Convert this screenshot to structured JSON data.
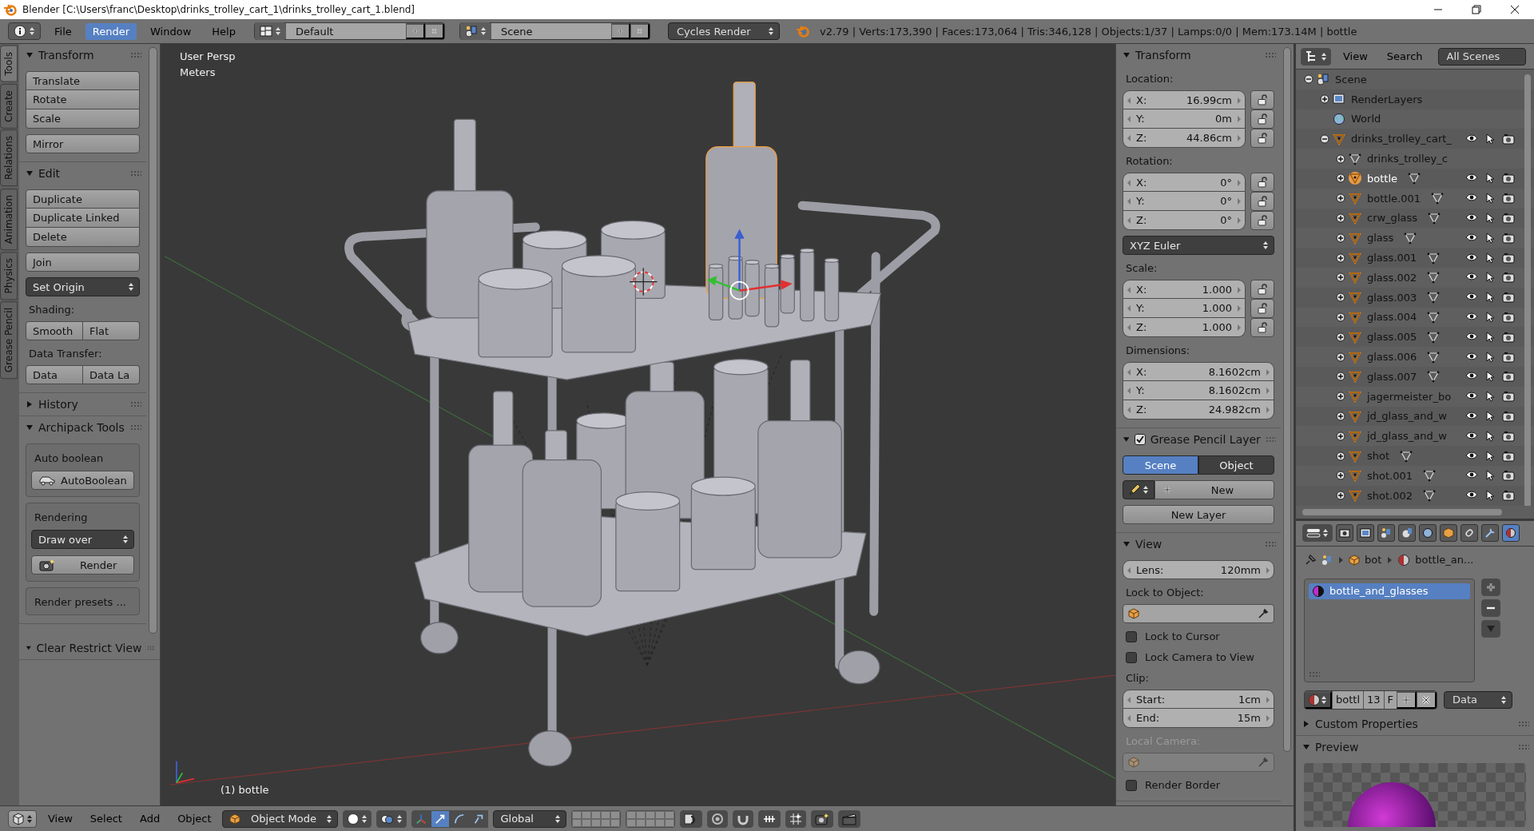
{
  "window": {
    "title": "Blender [C:\\Users\\franc\\Desktop\\drinks_trolley_cart_1\\drinks_trolley_cart_1.blend]"
  },
  "top_header": {
    "menus": [
      {
        "label": "File",
        "selected": false
      },
      {
        "label": "Render",
        "selected": true
      },
      {
        "label": "Window",
        "selected": false
      },
      {
        "label": "Help",
        "selected": false
      }
    ],
    "layout": "Default",
    "scene": "Scene",
    "engine": "Cycles Render",
    "stats": "v2.79 | Verts:173,390 | Faces:173,064 | Tris:346,128 | Objects:1/37 | Lamps:0/0 | Mem:173.14M | bottle"
  },
  "tool_tabs": [
    {
      "label": "Tools",
      "selected": true
    },
    {
      "label": "Create",
      "selected": false
    },
    {
      "label": "Relations",
      "selected": false
    },
    {
      "label": "Animation",
      "selected": false
    },
    {
      "label": "Physics",
      "selected": false
    },
    {
      "label": "Grease Pencil",
      "selected": false
    }
  ],
  "toolshelf": {
    "panels": [
      {
        "title": "Transform",
        "expanded": true,
        "items": [
          {
            "kind": "buttons",
            "labels": [
              "Translate",
              "Rotate",
              "Scale"
            ]
          },
          {
            "kind": "buttons",
            "labels": [
              "Mirror"
            ]
          }
        ]
      },
      {
        "title": "Edit",
        "expanded": true,
        "items": [
          {
            "kind": "buttons",
            "labels": [
              "Duplicate",
              "Duplicate Linked",
              "Delete"
            ]
          },
          {
            "kind": "buttons",
            "labels": [
              "Join"
            ]
          },
          {
            "kind": "dropdown",
            "value": "Set Origin"
          },
          {
            "kind": "label",
            "text": "Shading:"
          },
          {
            "kind": "row",
            "labels": [
              "Smooth",
              "Flat"
            ]
          },
          {
            "kind": "label",
            "text": "Data Transfer:"
          },
          {
            "kind": "row",
            "labels": [
              "Data",
              "Data La"
            ]
          }
        ]
      },
      {
        "title": "History",
        "expanded": false
      },
      {
        "title": "Archipack Tools",
        "expanded": true,
        "items": [
          {
            "kind": "box",
            "items": [
              {
                "kind": "label",
                "text": "Auto boolean"
              },
              {
                "kind": "icon_button",
                "label": "AutoBoolean"
              }
            ]
          },
          {
            "kind": "box",
            "items": [
              {
                "kind": "label",
                "text": "Rendering"
              },
              {
                "kind": "dropdown",
                "value": "Draw over"
              },
              {
                "kind": "icon_button",
                "label": "Render"
              }
            ]
          },
          {
            "kind": "box",
            "items": [
              {
                "kind": "label",
                "text": "Render presets ..."
              }
            ]
          }
        ]
      }
    ],
    "footer_panel": {
      "title": "Clear Restrict View",
      "expanded": true
    }
  },
  "viewport": {
    "view_name": "User Persp",
    "units": "Meters",
    "active_object": "(1) bottle"
  },
  "properties_region": {
    "panels": [
      {
        "title": "Transform",
        "expanded": true,
        "items": [
          {
            "kind": "label",
            "text": "Location:"
          },
          {
            "kind": "vector",
            "fields": [
              {
                "label": "X:",
                "value": "16.99cm",
                "locked": false
              },
              {
                "label": "Y:",
                "value": "0m",
                "locked": false
              },
              {
                "label": "Z:",
                "value": "44.86cm",
                "locked": false
              }
            ]
          },
          {
            "kind": "label",
            "text": "Rotation:"
          },
          {
            "kind": "vector",
            "fields": [
              {
                "label": "X:",
                "value": "0°",
                "locked": false
              },
              {
                "label": "Y:",
                "value": "0°",
                "locked": false
              },
              {
                "label": "Z:",
                "value": "0°",
                "locked": false
              }
            ]
          },
          {
            "kind": "dropdown",
            "value": "XYZ Euler"
          },
          {
            "kind": "label",
            "text": "Scale:"
          },
          {
            "kind": "vector",
            "fields": [
              {
                "label": "X:",
                "value": "1.000",
                "locked": false
              },
              {
                "label": "Y:",
                "value": "1.000",
                "locked": false
              },
              {
                "label": "Z:",
                "value": "1.000",
                "locked": false
              }
            ]
          },
          {
            "kind": "label",
            "text": "Dimensions:"
          },
          {
            "kind": "vector",
            "fields": [
              {
                "label": "X:",
                "value": "8.1602cm"
              },
              {
                "label": "Y:",
                "value": "8.1602cm"
              },
              {
                "label": "Z:",
                "value": "24.982cm"
              }
            ]
          }
        ]
      },
      {
        "title": "Grease Pencil Layer",
        "enabled": true,
        "expanded": true,
        "items": [
          {
            "kind": "tabs",
            "tabs": [
              {
                "label": "Scene",
                "selected": true
              },
              {
                "label": "Object",
                "selected": false
              }
            ]
          },
          {
            "kind": "new_row",
            "label": "New"
          },
          {
            "kind": "button",
            "label": "New Layer"
          }
        ]
      },
      {
        "title": "View",
        "expanded": true,
        "items": [
          {
            "kind": "vector",
            "fields": [
              {
                "label": "Lens:",
                "value": "120mm"
              }
            ]
          },
          {
            "kind": "label",
            "text": "Lock to Object:"
          },
          {
            "kind": "object_field",
            "disabled": false
          },
          {
            "kind": "checkbox",
            "label": "Lock to Cursor",
            "checked": false
          },
          {
            "kind": "checkbox",
            "label": "Lock Camera to View",
            "checked": false
          },
          {
            "kind": "label",
            "text": "Clip:"
          },
          {
            "kind": "vector",
            "fields": [
              {
                "label": "Start:",
                "value": "1cm"
              },
              {
                "label": "End:",
                "value": "15m"
              }
            ]
          },
          {
            "kind": "label",
            "text": "Local Camera:",
            "disabled": true
          },
          {
            "kind": "object_field",
            "disabled": true
          },
          {
            "kind": "checkbox",
            "label": "Render Border",
            "checked": false
          }
        ]
      }
    ]
  },
  "outliner": {
    "header": {
      "view": "View",
      "search": "Search",
      "filter": "All Scenes"
    },
    "tree": [
      {
        "name": "Scene",
        "kind": "scene",
        "expanded": true,
        "selected": false,
        "children": [
          {
            "name": "RenderLayers",
            "kind": "render_layers",
            "expanded": false,
            "selected": false
          },
          {
            "name": "World",
            "kind": "world",
            "selected": false
          },
          {
            "name": "drinks_trolley_cart_",
            "kind": "object",
            "expanded": true,
            "selected": false,
            "children": [
              {
                "name": "drinks_trolley_c",
                "kind": "mesh",
                "expanded": false,
                "selected": false
              },
              {
                "name": "bottle",
                "kind": "object",
                "expanded": false,
                "selected": true
              },
              {
                "name": "bottle.001",
                "kind": "object",
                "expanded": false,
                "selected": false
              },
              {
                "name": "crw_glass",
                "kind": "object",
                "expanded": false,
                "selected": false
              },
              {
                "name": "glass",
                "kind": "object",
                "expanded": false,
                "selected": false
              },
              {
                "name": "glass.001",
                "kind": "object",
                "expanded": false,
                "selected": false
              },
              {
                "name": "glass.002",
                "kind": "object",
                "expanded": false,
                "selected": false
              },
              {
                "name": "glass.003",
                "kind": "object",
                "expanded": false,
                "selected": false
              },
              {
                "name": "glass.004",
                "kind": "object",
                "expanded": false,
                "selected": false
              },
              {
                "name": "glass.005",
                "kind": "object",
                "expanded": false,
                "selected": false
              },
              {
                "name": "glass.006",
                "kind": "object",
                "expanded": false,
                "selected": false
              },
              {
                "name": "glass.007",
                "kind": "object",
                "expanded": false,
                "selected": false
              },
              {
                "name": "jagermeister_bo",
                "kind": "object",
                "expanded": false,
                "selected": false
              },
              {
                "name": "jd_glass_and_w",
                "kind": "object",
                "expanded": false,
                "selected": false
              },
              {
                "name": "jd_glass_and_w",
                "kind": "object",
                "expanded": false,
                "selected": false
              },
              {
                "name": "shot",
                "kind": "object",
                "expanded": false,
                "selected": false
              },
              {
                "name": "shot.001",
                "kind": "object",
                "expanded": false,
                "selected": false
              },
              {
                "name": "shot.002",
                "kind": "object",
                "expanded": false,
                "selected": false
              }
            ]
          }
        ]
      }
    ]
  },
  "properties": {
    "context_tabs": [
      {
        "selected": false
      },
      {
        "selected": false
      },
      {
        "selected": false
      },
      {
        "selected": false
      },
      {
        "selected": false
      },
      {
        "selected": false
      },
      {
        "selected": false
      },
      {
        "selected": false
      },
      {
        "selected": true
      }
    ],
    "breadcrumb": [
      "bot",
      "bottle_an..."
    ],
    "material_slots": [
      {
        "name": "bottle_and_glasses",
        "selected": true
      }
    ],
    "id_row": {
      "name": "bottl",
      "users": "13",
      "fake_user": "F",
      "link": "Data"
    },
    "panels": [
      {
        "title": "Custom Properties",
        "expanded": false
      },
      {
        "title": "Preview",
        "expanded": true
      }
    ]
  },
  "bottom_header": {
    "menus": [
      "View",
      "Select",
      "Add",
      "Object"
    ],
    "mode": "Object Mode",
    "orientation": "Global",
    "manipulators": [
      {
        "selected": false
      },
      {
        "selected": true
      },
      {
        "selected": false
      },
      {
        "selected": false
      }
    ]
  }
}
